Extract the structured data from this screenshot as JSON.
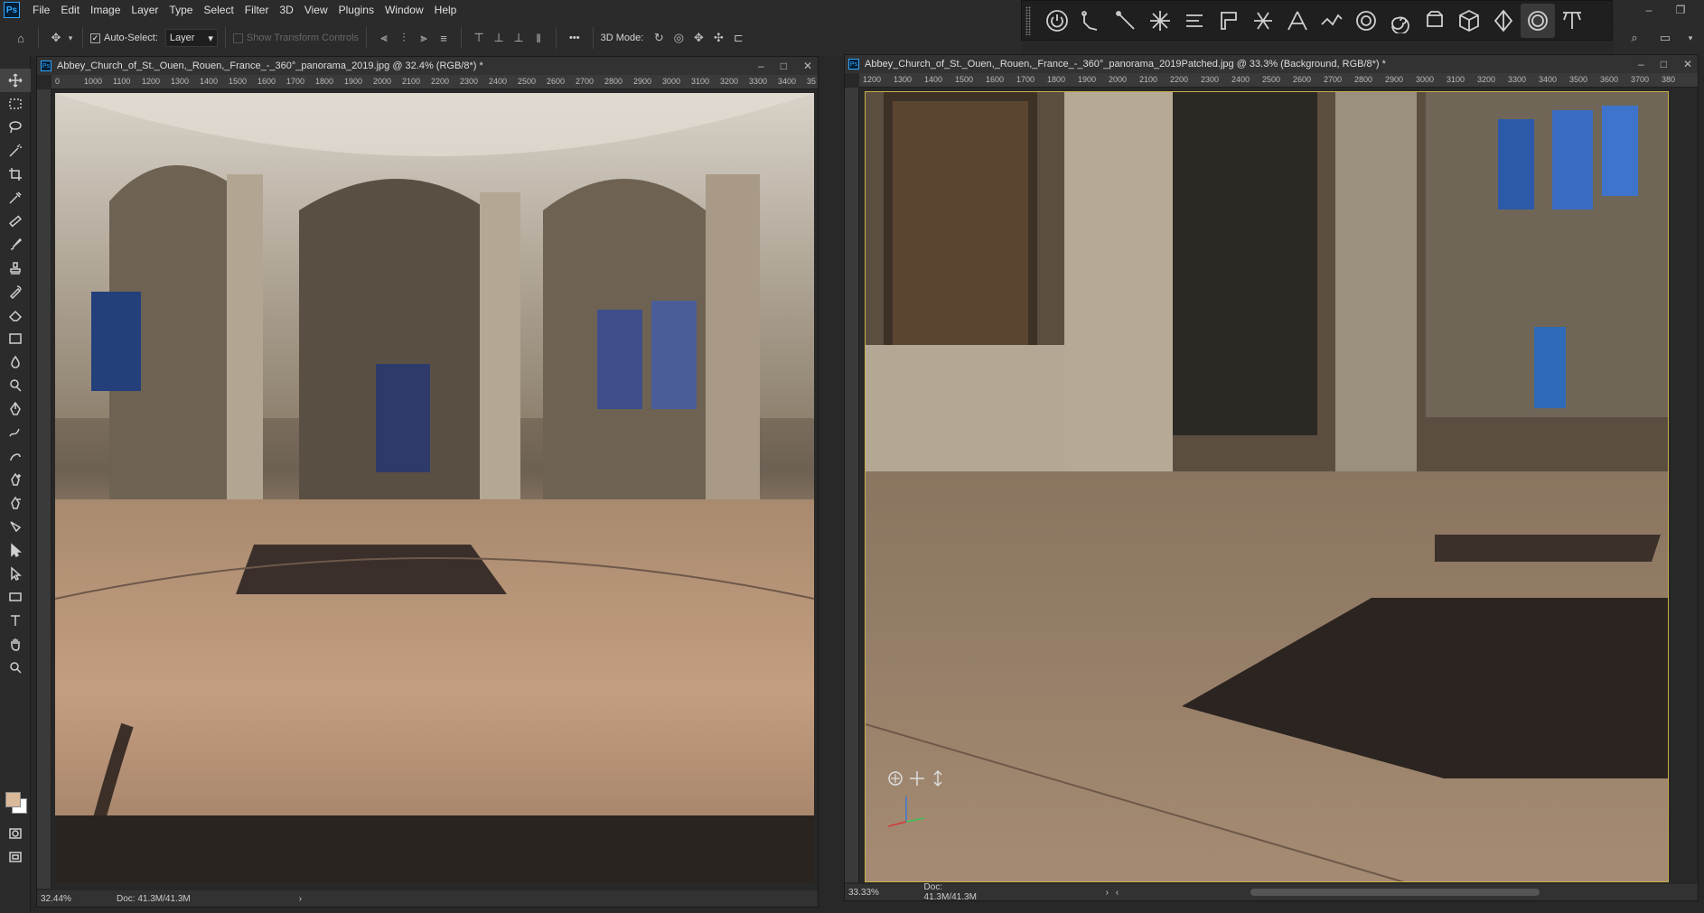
{
  "app": {
    "logo": "Ps"
  },
  "menu": [
    "File",
    "Edit",
    "Image",
    "Layer",
    "Type",
    "Select",
    "Filter",
    "3D",
    "View",
    "Plugins",
    "Window",
    "Help"
  ],
  "window_controls": {
    "minimize": "–",
    "restore": "❐"
  },
  "options_bar": {
    "auto_select_label": "Auto-Select:",
    "auto_select_checked": true,
    "layer_select_value": "Layer",
    "transform_controls_label": "Show Transform Controls",
    "more_label": "•••",
    "mode_label": "3D Mode:"
  },
  "panel3d": {
    "icons": [
      "power-icon",
      "joint-tool-icon",
      "bone-tool-icon",
      "star-burst-icon",
      "lines-icon",
      "rectangle-bracket-icon",
      "asterisk-icon",
      "cone-icon",
      "wave-icon",
      "ring-icon",
      "spiral-icon",
      "cylinder-icon",
      "cube-icon",
      "diamond-icon",
      "sphere-icon",
      "pyramid-icon"
    ],
    "active_icon": "sphere-icon"
  },
  "toolbar": {
    "tools": [
      "move-tool-icon",
      "marquee-tool-icon",
      "lasso-tool-icon",
      "magic-wand-icon",
      "crop-tool-icon",
      "eyedropper-icon",
      "healing-brush-icon",
      "brush-tool-icon",
      "clone-stamp-icon",
      "history-brush-icon",
      "eraser-icon",
      "gradient-icon",
      "blur-tool-icon",
      "dodge-tool-icon",
      "pen-tool-icon",
      "freeform-pen-icon",
      "curvature-pen-icon",
      "add-anchor-icon",
      "delete-anchor-icon",
      "convert-point-icon",
      "path-select-icon",
      "direct-select-icon",
      "rectangle-tool-icon",
      "type-tool-icon",
      "hand-tool-icon",
      "zoom-tool-icon"
    ],
    "selected_tool": "move-tool-icon",
    "foreground_color": "#d9b99a",
    "background_color": "#ffffff"
  },
  "doc_left": {
    "title": "Abbey_Church_of_St._Ouen,_Rouen,_France_-_360°_panorama_2019.jpg @ 32.4% (RGB/8*) *",
    "zoom": "32.44%",
    "doc_info": "Doc: 41.3M/41.3M",
    "ruler_ticks": [
      "0",
      "1000",
      "1100",
      "1200",
      "1300",
      "1400",
      "1500",
      "1600",
      "1700",
      "1800",
      "1900",
      "2000",
      "2100",
      "2200",
      "2300",
      "2400",
      "2500",
      "2600",
      "2700",
      "2800",
      "2900",
      "3000",
      "3100",
      "3200",
      "3300",
      "3400",
      "35"
    ]
  },
  "doc_right": {
    "title": "Abbey_Church_of_St._Ouen,_Rouen,_France_-_360°_panorama_2019Patched.jpg @ 33.3% (Background, RGB/8*) *",
    "zoom": "33.33%",
    "doc_info": "Doc: 41.3M/41.3M",
    "ruler_ticks": [
      "1200",
      "1300",
      "1400",
      "1500",
      "1600",
      "1700",
      "1800",
      "1900",
      "2000",
      "2100",
      "2200",
      "2300",
      "2400",
      "2500",
      "2600",
      "2700",
      "2800",
      "2900",
      "3000",
      "3100",
      "3200",
      "3300",
      "3400",
      "3500",
      "3600",
      "3700",
      "380"
    ]
  },
  "colors": {
    "accent": "#31a8ff",
    "ui_bg": "#2b2b2b",
    "canvas_border": "#c9b04a"
  }
}
